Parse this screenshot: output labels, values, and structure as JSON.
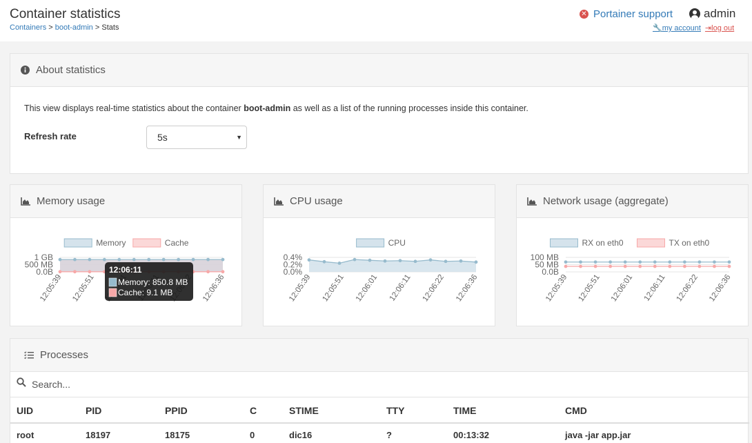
{
  "header": {
    "title": "Container statistics",
    "breadcrumb": {
      "containers": "Containers",
      "sep1": ">",
      "container": "boot-admin",
      "sep2": ">",
      "current": "Stats"
    },
    "support_label": "Portainer support",
    "username": "admin",
    "my_account": "my account",
    "log_out": "log out"
  },
  "about": {
    "title": "About statistics",
    "text_before": "This view displays real-time statistics about the container ",
    "container": "boot-admin",
    "text_after": " as well as a list of the running processes inside this container.",
    "refresh_label": "Refresh rate",
    "refresh_value": "5s"
  },
  "memory_chart": {
    "title": "Memory usage",
    "legend": [
      "Memory",
      "Cache"
    ],
    "tooltip": {
      "title": "12:06:11",
      "memory": "Memory: 850.8 MB",
      "cache": "Cache: 9.1 MB"
    }
  },
  "cpu_chart": {
    "title": "CPU usage",
    "legend": [
      "CPU"
    ]
  },
  "network_chart": {
    "title": "Network usage (aggregate)",
    "legend": [
      "RX on eth0",
      "TX on eth0"
    ]
  },
  "colors": {
    "series_a": "#97bbcd",
    "series_a_fill": "#d5e3ec",
    "series_b": "#f7a8a8",
    "series_b_fill": "#fbd8d8",
    "link": "#337ab7",
    "danger": "#d9534f"
  },
  "chart_data": [
    {
      "type": "area",
      "title": "Memory usage",
      "x": [
        "12:05:39",
        "12:05:51",
        "12:06:01",
        "12:06:11",
        "12:06:22",
        "12:06:36"
      ],
      "y_ticks": [
        "1 GB",
        "500 MB",
        "0.0B"
      ],
      "ylim": [
        0,
        1000
      ],
      "series": [
        {
          "name": "Memory",
          "values": [
            850,
            850,
            850,
            850,
            850,
            850,
            851,
            851,
            851,
            851,
            851,
            851
          ]
        },
        {
          "name": "Cache",
          "values": [
            9,
            9,
            9,
            9,
            9,
            9,
            9,
            9,
            9,
            9,
            9,
            9
          ]
        }
      ],
      "legend": "top"
    },
    {
      "type": "area",
      "title": "CPU usage",
      "x": [
        "12:05:39",
        "12:05:51",
        "12:06:01",
        "12:06:11",
        "12:06:22",
        "12:06:36"
      ],
      "y_ticks": [
        "0.4%",
        "0.2%",
        "0.0%"
      ],
      "ylim": [
        0,
        0.4
      ],
      "series": [
        {
          "name": "CPU",
          "values": [
            0.33,
            0.28,
            0.24,
            0.34,
            0.32,
            0.3,
            0.31,
            0.29,
            0.33,
            0.29,
            0.3,
            0.27
          ]
        }
      ],
      "legend": "top"
    },
    {
      "type": "line",
      "title": "Network usage (aggregate)",
      "x": [
        "12:05:39",
        "12:05:51",
        "12:06:01",
        "12:06:11",
        "12:06:22",
        "12:06:36"
      ],
      "y_ticks": [
        "100 MB",
        "50 MB",
        "0.0B"
      ],
      "ylim": [
        0,
        100
      ],
      "series": [
        {
          "name": "RX on eth0",
          "values": [
            68,
            68,
            68,
            68,
            68,
            68,
            68,
            68,
            68,
            68,
            68,
            68
          ]
        },
        {
          "name": "TX on eth0",
          "values": [
            38,
            38,
            38,
            38,
            38,
            38,
            38,
            38,
            38,
            38,
            38,
            38
          ]
        }
      ],
      "legend": "top"
    }
  ],
  "processes": {
    "title": "Processes",
    "search_placeholder": "Search...",
    "columns": [
      "UID",
      "PID",
      "PPID",
      "C",
      "STIME",
      "TTY",
      "TIME",
      "CMD"
    ],
    "rows": [
      [
        "root",
        "18197",
        "18175",
        "0",
        "dic16",
        "?",
        "00:13:32",
        "java -jar app.jar"
      ]
    ]
  }
}
